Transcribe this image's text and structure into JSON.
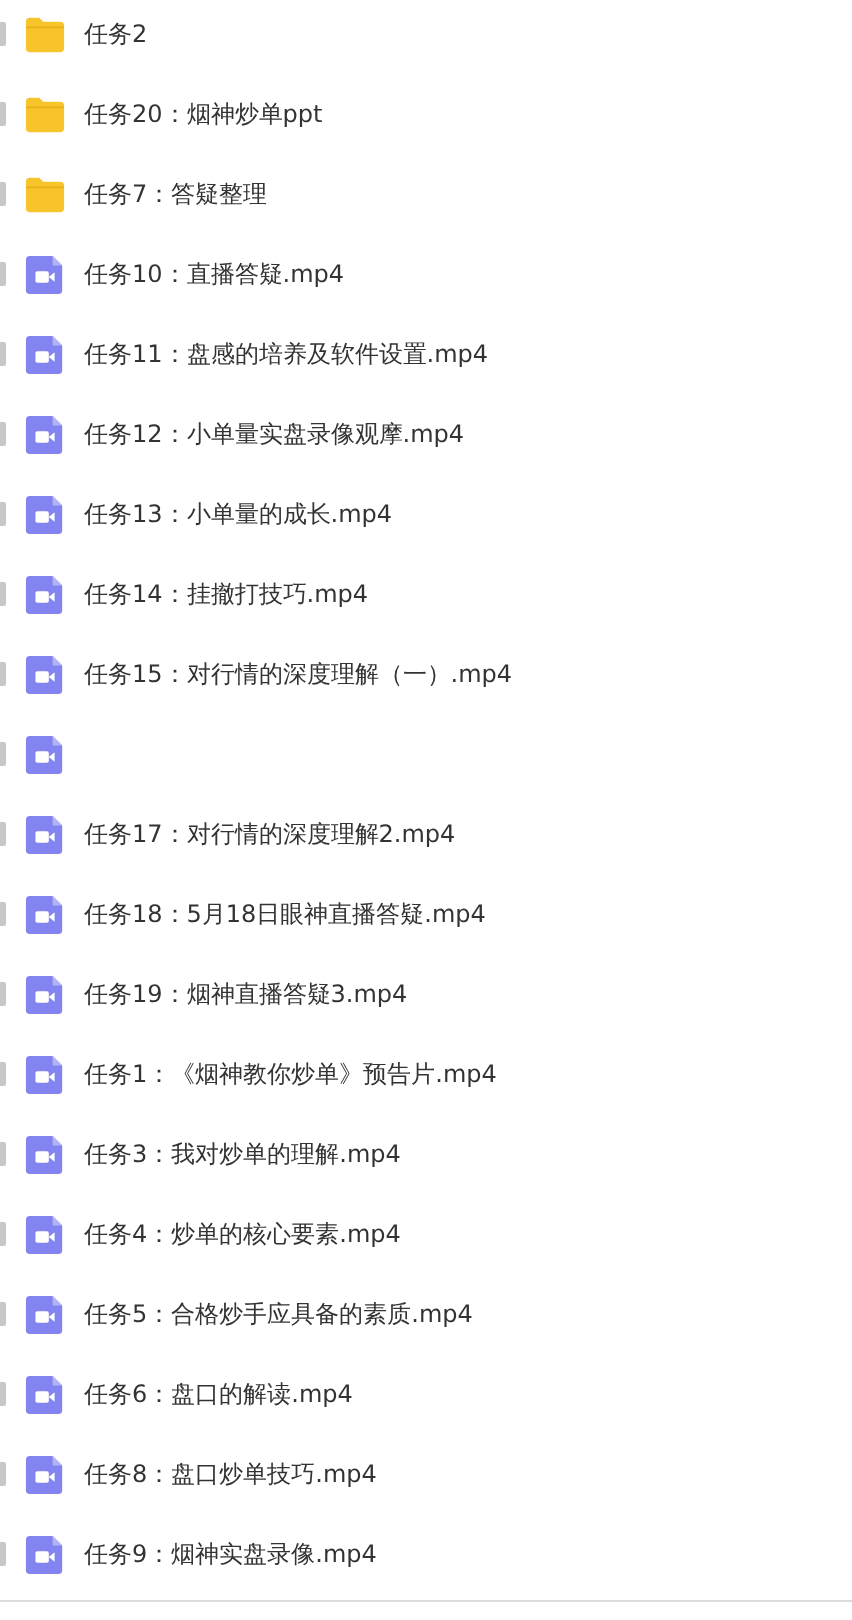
{
  "files": [
    {
      "kind": "folder",
      "checked": false,
      "name": "任务2"
    },
    {
      "kind": "folder",
      "checked": false,
      "name": "任务20：烟神炒单ppt"
    },
    {
      "kind": "folder",
      "checked": false,
      "name": "任务7：答疑整理"
    },
    {
      "kind": "video",
      "checked": false,
      "name": "任务10：直播答疑.mp4"
    },
    {
      "kind": "video",
      "checked": false,
      "name": "任务11：盘感的培养及软件设置.mp4"
    },
    {
      "kind": "video",
      "checked": false,
      "name": "任务12：小单量实盘录像观摩.mp4"
    },
    {
      "kind": "video",
      "checked": false,
      "name": "任务13：小单量的成长.mp4"
    },
    {
      "kind": "video",
      "checked": false,
      "name": "任务14：挂撤打技巧.mp4"
    },
    {
      "kind": "video",
      "checked": false,
      "name": "任务15：对行情的深度理解（一）.mp4"
    },
    {
      "kind": "video",
      "checked": false
    },
    {
      "kind": "video",
      "checked": false,
      "name": "任务17：对行情的深度理解2.mp4"
    },
    {
      "kind": "video",
      "checked": false,
      "name": "任务18：5月18日眼神直播答疑.mp4"
    },
    {
      "kind": "video",
      "checked": false,
      "name": "任务19：烟神直播答疑3.mp4"
    },
    {
      "kind": "video",
      "checked": false,
      "name": "任务1：《烟神教你炒单》预告片.mp4"
    },
    {
      "kind": "video",
      "checked": false,
      "name": "任务3：我对炒单的理解.mp4"
    },
    {
      "kind": "video",
      "checked": false,
      "name": "任务4：炒单的核心要素.mp4"
    },
    {
      "kind": "video",
      "checked": false,
      "name": "任务5：合格炒手应具备的素质.mp4"
    },
    {
      "kind": "video",
      "checked": false,
      "name": "任务6：盘口的解读.mp4"
    },
    {
      "kind": "video",
      "checked": false,
      "name": "任务8：盘口炒单技巧.mp4"
    },
    {
      "kind": "video",
      "checked": false,
      "name": "任务9：烟神实盘录像.mp4"
    }
  ]
}
